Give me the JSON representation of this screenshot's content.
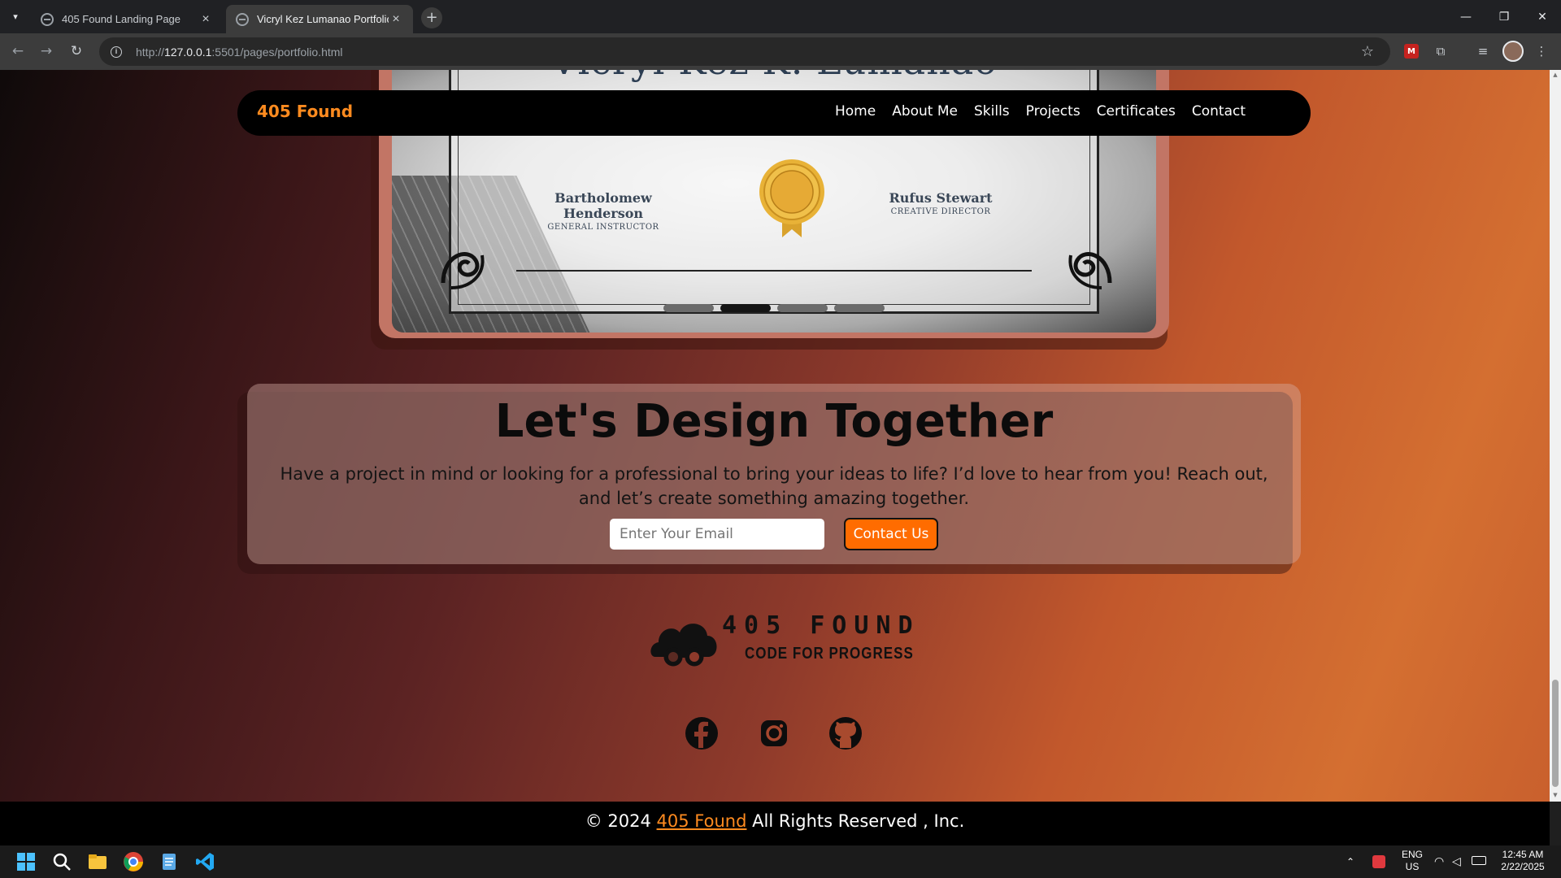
{
  "browser": {
    "tabs": [
      {
        "title": "405 Found Landing Page",
        "active": false
      },
      {
        "title": "Vicryl Kez Lumanao Portfolio",
        "active": true
      }
    ],
    "url_prefix": "http://",
    "url_host": "127.0.0.1",
    "url_rest": ":5501/pages/portfolio.html"
  },
  "navbar": {
    "brand": "405 Found",
    "links": [
      "Home",
      "About Me",
      "Skills",
      "Projects",
      "Certificates",
      "Contact"
    ]
  },
  "certificate": {
    "name": "Vicryl Kez K. Lumanao",
    "signer_left": {
      "name": "Bartholomew Henderson",
      "role": "GENERAL INSTRUCTOR"
    },
    "signer_right": {
      "name": "Rufus Stewart",
      "role": "CREATIVE DIRECTOR"
    },
    "slides_total": 4,
    "active_slide": 2
  },
  "cta": {
    "heading": "Let's Design Together",
    "body": "Have a project in mind or looking for a professional to bring your ideas to life? I’d love to hear from you! Reach out, and let’s create something amazing together.",
    "email_placeholder": "Enter Your Email",
    "button": "Contact Us"
  },
  "footer": {
    "logo_title": "405 FOUND",
    "logo_subtitle": "CODE FOR PROGRESS",
    "social": [
      "facebook-icon",
      "instagram-icon",
      "github-icon"
    ],
    "copyright_prefix": "© 2024",
    "copyright_link": "405 Found",
    "copyright_suffix": "All Rights Reserved , Inc."
  },
  "taskbar": {
    "lang_top": "ENG",
    "lang_bottom": "US",
    "time": "12:45 AM",
    "date": "2/22/2025"
  },
  "colors": {
    "accent": "#ff8b1f",
    "button": "#ff6c00"
  }
}
